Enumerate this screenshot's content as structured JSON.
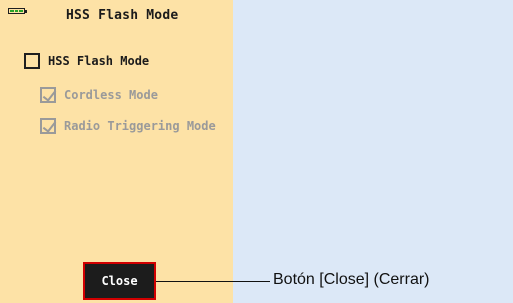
{
  "screen": {
    "title": "HSS Flash Mode",
    "battery_icon": "battery-icon",
    "colors": {
      "background": "#fde2a6",
      "accent": "#d10000",
      "button_fill": "#1c1c1c",
      "battery": "#27a327"
    },
    "options": [
      {
        "label": "HSS Flash Mode",
        "checked": false,
        "enabled": true
      },
      {
        "label": "Cordless Mode",
        "checked": true,
        "enabled": false
      },
      {
        "label": "Radio Triggering Mode",
        "checked": true,
        "enabled": false
      }
    ],
    "close_button": {
      "label": "Close"
    }
  },
  "callout": {
    "label": "Botón [Close] (Cerrar)"
  }
}
